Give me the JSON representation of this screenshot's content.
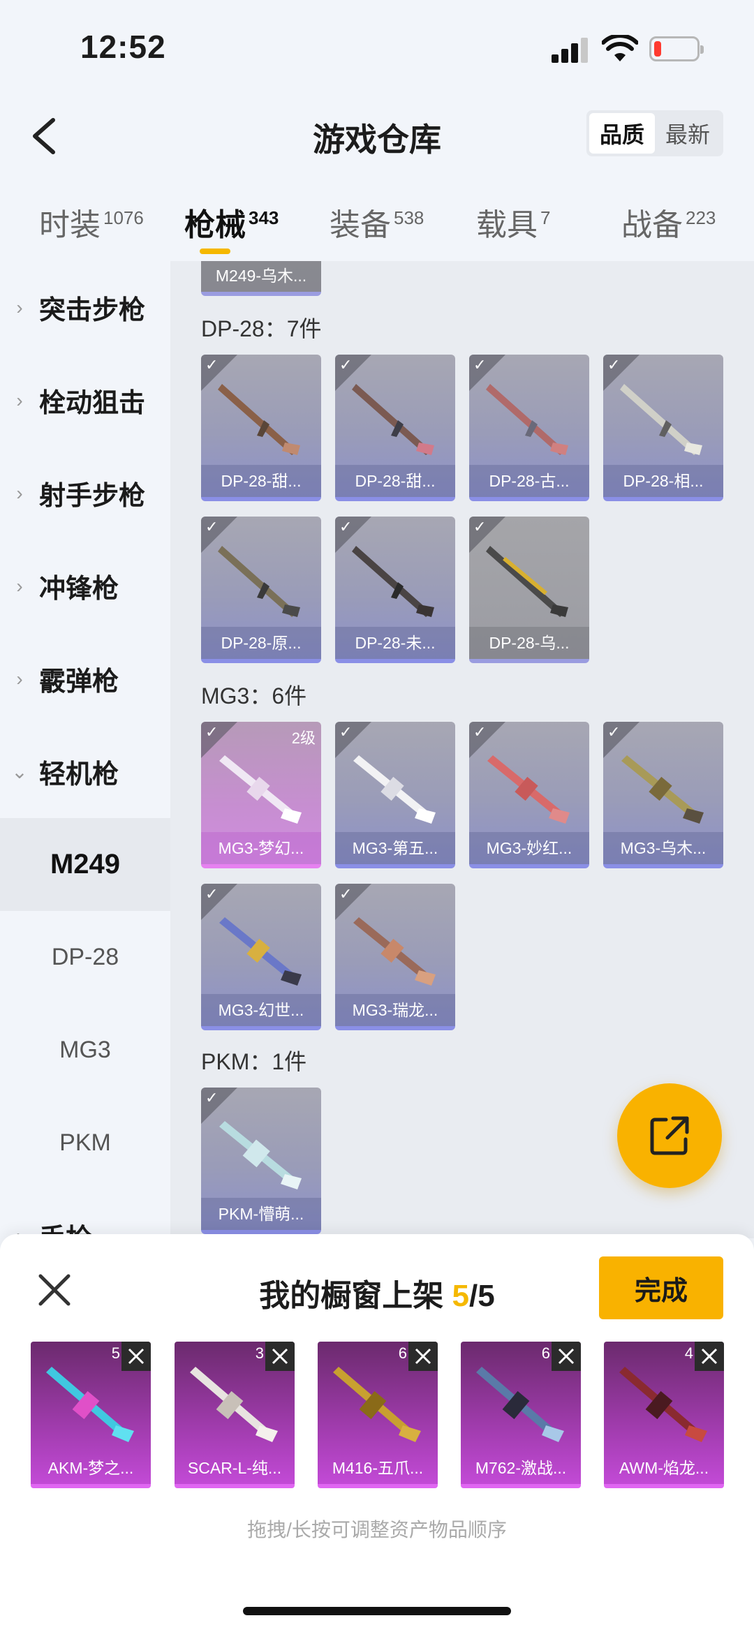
{
  "status": {
    "time": "12:52"
  },
  "header": {
    "title": "游戏仓库",
    "sort": [
      "品质",
      "最新"
    ]
  },
  "tabs": [
    {
      "label": "时装",
      "count": "1076"
    },
    {
      "label": "枪械",
      "count": "343"
    },
    {
      "label": "装备",
      "count": "538"
    },
    {
      "label": "载具",
      "count": "7"
    },
    {
      "label": "战备",
      "count": "223"
    }
  ],
  "sidebar": {
    "categories": [
      "突击步枪",
      "栓动狙击",
      "射手步枪",
      "冲锋枪",
      "霰弹枪",
      "轻机枪",
      "手枪"
    ],
    "subitems": [
      "M249",
      "DP-28",
      "MG3",
      "PKM"
    ]
  },
  "main": {
    "top_partial": "M249-乌木...",
    "sections": [
      {
        "title": "DP-28：7件",
        "items": [
          "DP-28-甜...",
          "DP-28-甜...",
          "DP-28-古...",
          "DP-28-相...",
          "DP-28-原...",
          "DP-28-未...",
          "DP-28-乌..."
        ]
      },
      {
        "title": "MG3：6件",
        "items": [
          "MG3-梦幻...",
          "MG3-第五...",
          "MG3-妙红...",
          "MG3-乌木...",
          "MG3-幻世...",
          "MG3-瑞龙..."
        ],
        "level_badge": "2级"
      },
      {
        "title": "PKM：1件",
        "items": [
          "PKM-懵萌..."
        ]
      }
    ]
  },
  "sheet": {
    "title": "我的橱窗上架",
    "count_current": "5",
    "count_total": "/5",
    "done_label": "完成",
    "slots": [
      {
        "name": "AKM-梦之...",
        "lvl": "5"
      },
      {
        "name": "SCAR-L-纯...",
        "lvl": "3"
      },
      {
        "name": "M416-五爪...",
        "lvl": "6"
      },
      {
        "name": "M762-激战...",
        "lvl": "6"
      },
      {
        "name": "AWM-焰龙...",
        "lvl": "4"
      }
    ],
    "hint": "拖拽/长按可调整资产物品顺序"
  }
}
